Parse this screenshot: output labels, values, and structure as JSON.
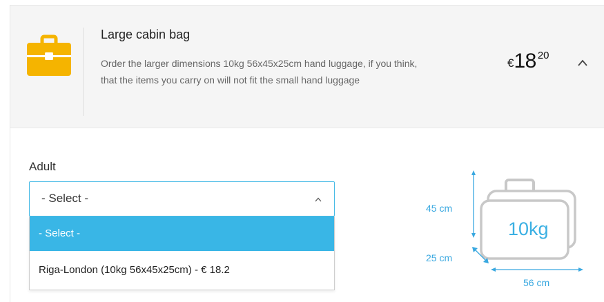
{
  "product": {
    "title": "Large cabin bag",
    "description": "Order the larger dimensions 10kg 56x45x25cm hand luggage, if you think, that the items you carry on will not fit the small hand luggage",
    "icon": "briefcase-icon",
    "icon_color": "#f5b400",
    "price": {
      "currency": "€",
      "integer": "18",
      "decimal": "20"
    }
  },
  "passenger": {
    "label": "Adult",
    "select": {
      "value": "- Select -",
      "options": [
        "- Select -",
        "Riga-London (10kg 56x45x25cm) - € 18.2"
      ]
    }
  },
  "bag_diagram": {
    "weight": "10kg",
    "height": "45 cm",
    "depth": "25 cm",
    "width": "56 cm",
    "accent": "#39a8e0",
    "outline": "#c8c8c8"
  }
}
